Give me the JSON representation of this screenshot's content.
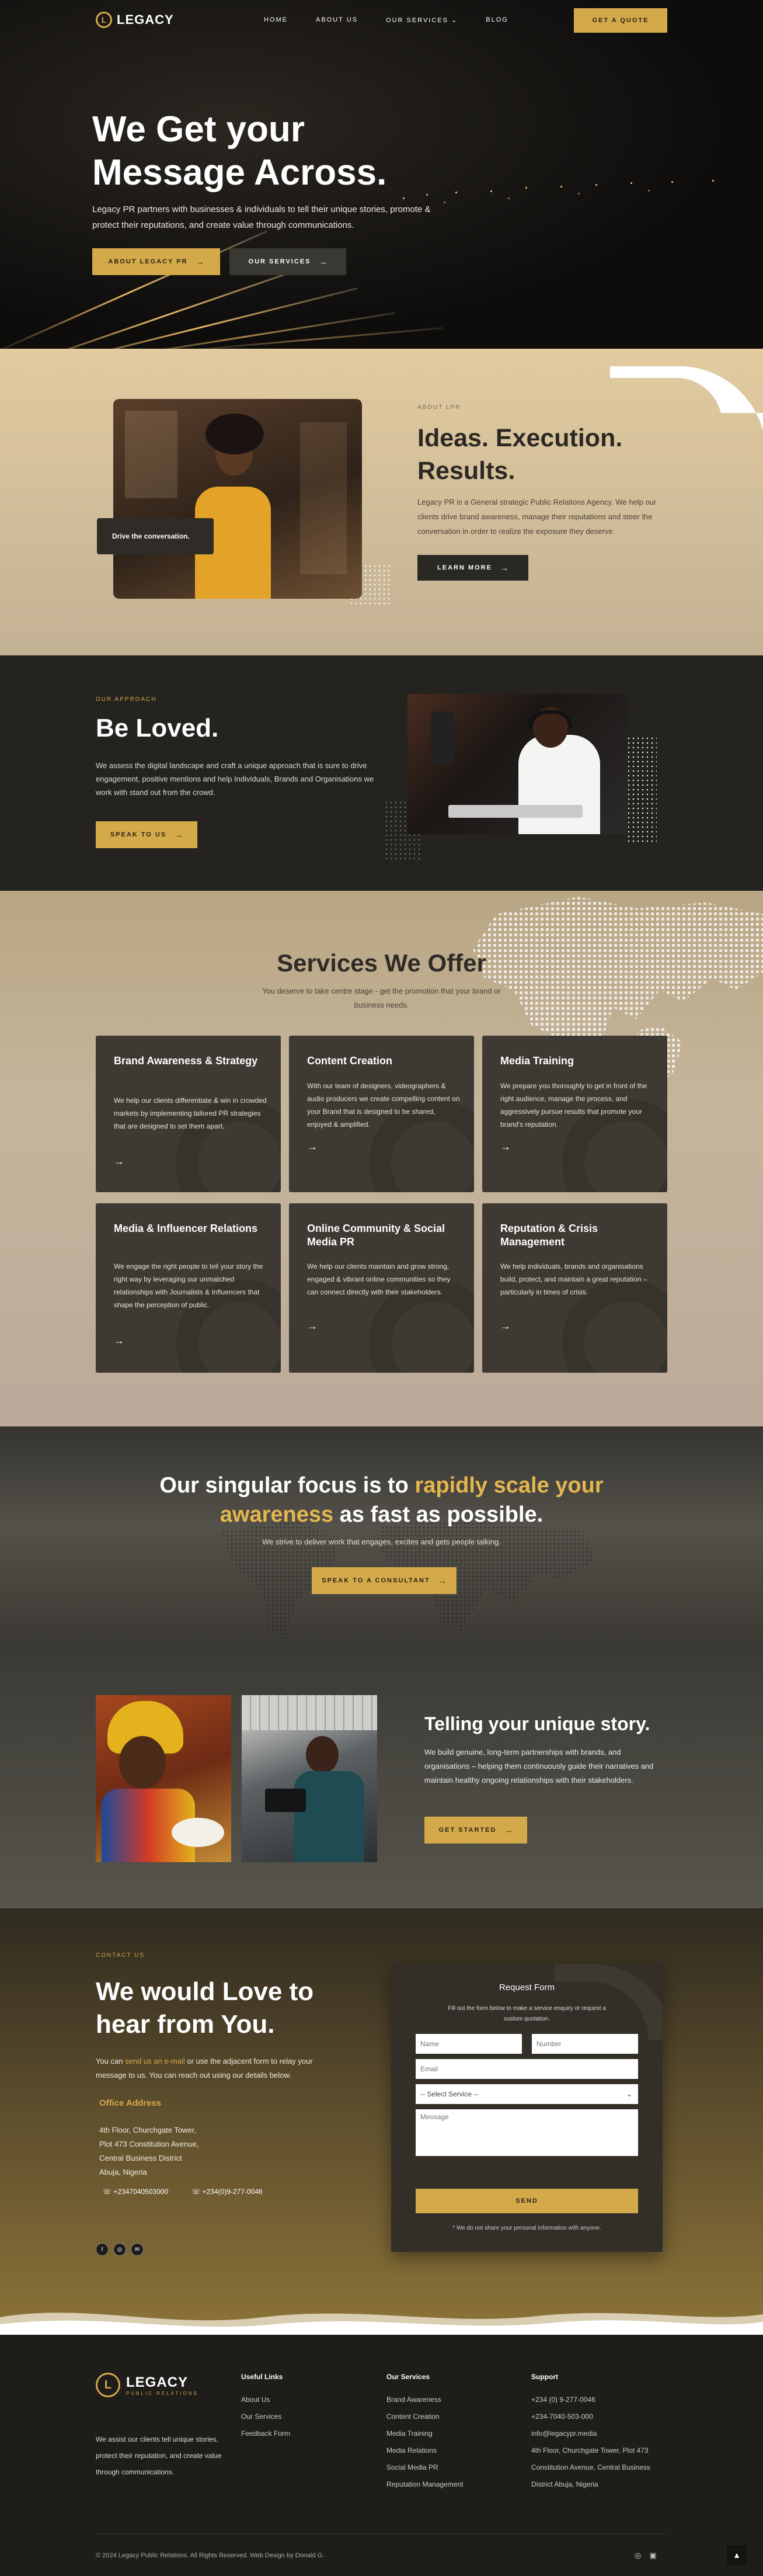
{
  "colors": {
    "accent": "#d4a94a",
    "dark": "#242320",
    "card": "#3e3a33"
  },
  "nav": {
    "logo": "LEGACY",
    "links": [
      "HOME",
      "ABOUT US",
      "OUR SERVICES",
      "BLOG"
    ],
    "services_chevron": "chevron-down-icon",
    "quote_button": "GET A QUOTE"
  },
  "hero": {
    "title": "We Get your Message Across.",
    "subtitle": "Legacy PR partners with businesses & individuals to tell their unique stories, promote & protect their reputations, and create value through communications.",
    "button_primary": "ABOUT LEGACY PR",
    "button_secondary": "OUR SERVICES"
  },
  "about": {
    "tag": "ABOUT LPR",
    "title": "Ideas. Execution. Results.",
    "text": "Legacy PR is a General strategic Public Relations Agency. We help our clients drive brand awareness, manage their reputations and steer the conversation in order to realize the exposure they deserve.",
    "button": "LEARN MORE",
    "caption": "Drive the conversation."
  },
  "approach": {
    "tag": "OUR APPROACH",
    "title": "Be Loved.",
    "text": "We assess the digital landscape and craft a unique approach that is sure to drive engagement, positive mentions and help Individuals, Brands and Organisations we work with stand out from the crowd.",
    "button": "SPEAK TO US"
  },
  "services": {
    "title": "Services We Offer",
    "subtitle": "You deserve to take centre stage - get the promotion that your brand or business needs.",
    "cards": [
      {
        "title": "Brand Awareness & Strategy",
        "text": "We help our clients differentiate & win in crowded markets by implementing tailored PR strategies that are designed to set them apart."
      },
      {
        "title": "Content Creation",
        "text": "With our team of designers, videographers & audio producers we create compelling content on your Brand that is designed to be shared, enjoyed & amplified."
      },
      {
        "title": "Media Training",
        "text": "We prepare you thoroughly to get in front of the right audience, manage the process, and aggressively pursue results that promote your brand's reputation."
      },
      {
        "title": "Media & Influencer Relations",
        "text": "We engage the right people to tell your story the right way by leveraging our unmatched relationships with Journalists & Influencers that shape the perception of public."
      },
      {
        "title": "Online Community & Social Media PR",
        "text": "We help our clients maintain and grow strong, engaged & vibrant online communities so they can connect directly with their stakeholders."
      },
      {
        "title": "Reputation & Crisis Management",
        "text": "We help individuals, brands and organisations build, protect, and maintain a great reputation – particularly in times of crisis."
      }
    ]
  },
  "focus": {
    "title_part1": "Our singular focus is to ",
    "title_highlight": "rapidly scale your awareness",
    "title_part2": " as fast as possible.",
    "subtitle": "We strive to deliver work that engages, excites and gets people talking.",
    "button": "SPEAK TO A CONSULTANT"
  },
  "story": {
    "title": "Telling your unique story.",
    "text": "We build genuine, long-term partnerships with brands, and organisations – helping them continuously guide their narratives and maintain healthy ongoing relationships with their stakeholders.",
    "button": "GET STARTED"
  },
  "contact": {
    "tag": "CONTACT US",
    "title": "We would Love to hear from You.",
    "text_before": "You can ",
    "text_link": "send us an e-mail",
    "text_after": " or use the adjacent form to relay your message to us. You can reach out using our details below.",
    "office_title": "Office Address",
    "address": [
      "4th Floor, Churchgate Tower,",
      "Plot 473 Constitution Avenue,",
      "Central Business District",
      "Abuja, Nigeria"
    ],
    "phones": [
      "+2347040503000",
      "+234(0)9-277-0046"
    ],
    "social_icons": [
      "facebook-icon",
      "instagram-icon",
      "email-icon"
    ]
  },
  "form": {
    "title": "Request Form",
    "subtitle": "Fill out the form below to make a service enquiry or request a custom quotation.",
    "name_placeholder": "Name",
    "number_placeholder": "Number",
    "email_placeholder": "Email",
    "service_select": "-- Select Service --",
    "message_placeholder": "Message",
    "send": "SEND",
    "note": "* We do not share your personal information with anyone."
  },
  "footer": {
    "logo": "LEGACY",
    "logo_sub": "PUBLIC RELATIONS",
    "about": "We assist our clients tell unique stories, protect their reputation, and create value through communications.",
    "useful_title": "Useful Links",
    "useful_links": [
      "About Us",
      "Our Services",
      "Feedback Form"
    ],
    "services_title": "Our Services",
    "services_links": [
      "Brand Awareness",
      "Content Creation",
      "Media Training",
      "Media Relations",
      "Social Media PR",
      "Reputation Management"
    ],
    "support_title": "Support",
    "support_lines": [
      "+234 (0) 9-277-0046",
      "+234-7040-503-000",
      "info@legacypr.media",
      "4th Floor, Churchgate Tower, Plot 473",
      "Constitution Avenue, Central Business",
      "District Abuja, Nigeria"
    ],
    "copyright": "© 2024 Legacy Public Relations. All Rights Reserved. Web Design by Donald G.",
    "back_to_top": "▲"
  }
}
